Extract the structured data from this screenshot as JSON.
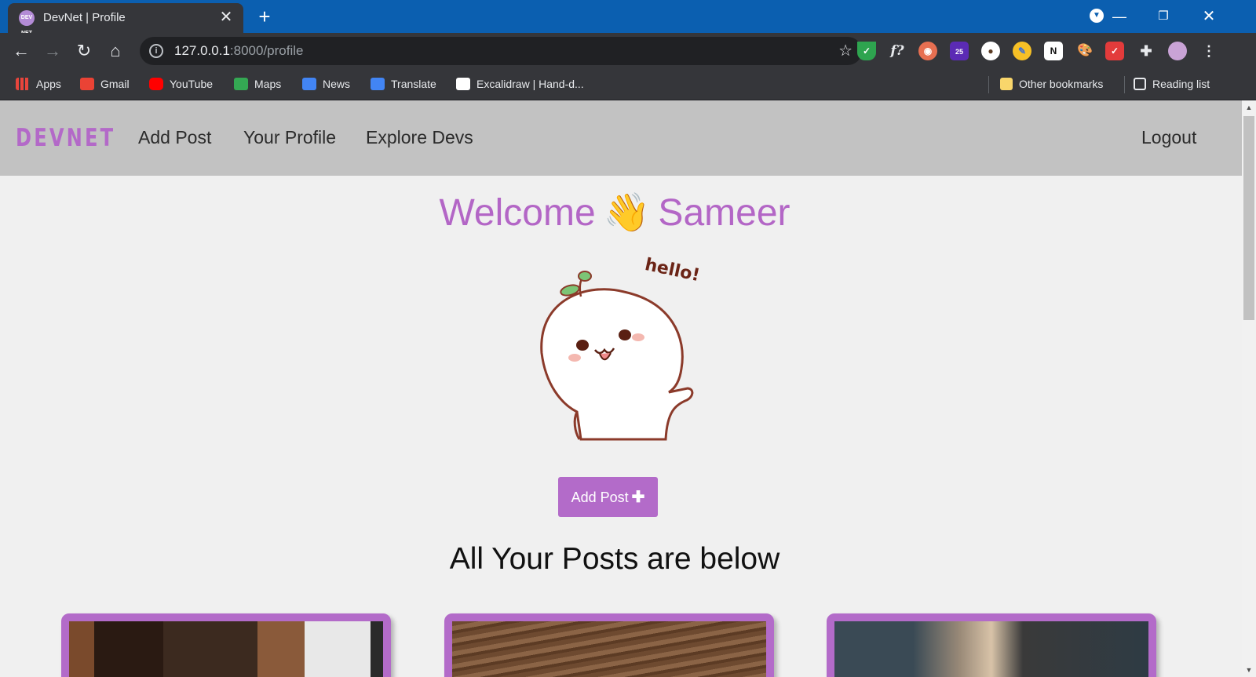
{
  "browser": {
    "tab_title": "DevNet | Profile",
    "favicon_text": "DEV NET",
    "url_host": "127.0.0.1",
    "url_path": ":8000/profile",
    "extension_badge": "25",
    "bookmarks": [
      {
        "label": "Apps",
        "icon": "apps-grid-icon",
        "color": "#e8453c"
      },
      {
        "label": "Gmail",
        "icon": "gmail-icon",
        "color": "#ea4335"
      },
      {
        "label": "YouTube",
        "icon": "youtube-icon",
        "color": "#ff0000"
      },
      {
        "label": "Maps",
        "icon": "maps-icon",
        "color": "#34a853"
      },
      {
        "label": "News",
        "icon": "news-icon",
        "color": "#4285f4"
      },
      {
        "label": "Translate",
        "icon": "translate-icon",
        "color": "#4285f4"
      },
      {
        "label": "Excalidraw | Hand-d...",
        "icon": "excalidraw-icon",
        "color": "#ffffff"
      }
    ],
    "other_bookmarks": "Other bookmarks",
    "reading_list": "Reading list"
  },
  "site": {
    "brand": "DEVNET",
    "nav": {
      "add_post": "Add Post",
      "your_profile": "Your Profile",
      "explore_devs": "Explore Devs",
      "logout": "Logout"
    },
    "welcome_word": "Welcome",
    "wave_emoji": "👋",
    "username": "Sameer",
    "mascot_caption": "hello!",
    "add_post_button": "Add Post",
    "posts_heading": "All Your Posts are below",
    "accent_color": "#b366c6",
    "nav_bg_color": "#c2c2c2",
    "post_count_visible": 3
  }
}
